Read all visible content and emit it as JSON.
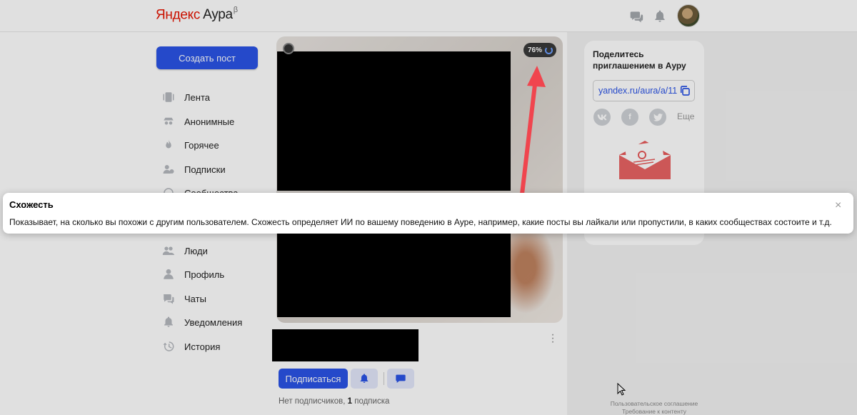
{
  "header": {
    "logo_brand": "Яндекс",
    "logo_product": "Аура",
    "logo_beta": "β",
    "icons": [
      "chat-icon",
      "bell-icon"
    ]
  },
  "sidebar": {
    "create_button": "Создать пост",
    "items": [
      {
        "label": "Лента",
        "icon": "feed-icon"
      },
      {
        "label": "Анонимные",
        "icon": "anonymous-icon"
      },
      {
        "label": "Горячее",
        "icon": "fire-icon"
      },
      {
        "label": "Подписки",
        "icon": "subscriptions-icon"
      },
      {
        "label": "Сообщества",
        "icon": "communities-icon"
      },
      {
        "label": "Люди",
        "icon": "people-icon"
      },
      {
        "label": "Профиль",
        "icon": "profile-icon"
      },
      {
        "label": "Чаты",
        "icon": "chats-icon"
      },
      {
        "label": "Уведомления",
        "icon": "notifications-icon"
      },
      {
        "label": "История",
        "icon": "history-icon"
      }
    ]
  },
  "post": {
    "similarity": "76%",
    "subscribe_button": "Подписаться",
    "subs_prefix": "Нет подписчиков, ",
    "subs_count": "1",
    "subs_suffix": " подписка"
  },
  "invite": {
    "title": "Поделитесь приглашением в Ауру",
    "link": "yandex.ru/aura/a/11",
    "social": [
      "vk",
      "f",
      "twitter"
    ],
    "more": "Еще"
  },
  "footer": {
    "agreement": "Пользовательское соглашение",
    "content_rules": "Требование к контенту"
  },
  "tooltip": {
    "title": "Схожесть",
    "text": "Показывает, на сколько вы похожи с другим пользователем. Схожесть определяет ИИ по вашему поведению в Ауре, например, какие посты вы лайкали или пропустили, в каких сообществах состоите и т.д.",
    "close": "×"
  },
  "colors": {
    "accent": "#2b54e6",
    "brand_red": "#e61400",
    "arrow": "#f0454e"
  }
}
